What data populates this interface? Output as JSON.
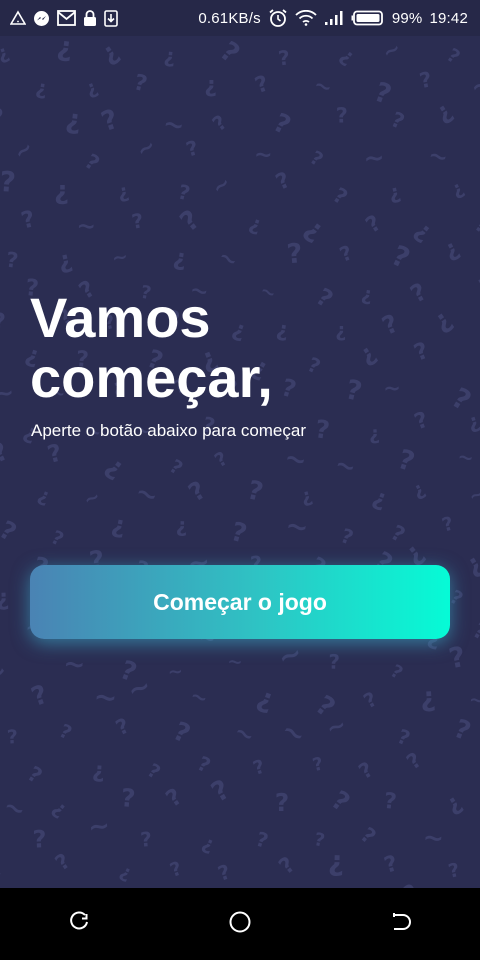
{
  "status_bar": {
    "left_icons": [
      "alert-triangle-icon",
      "messenger-icon",
      "gmail-icon",
      "lock-icon",
      "download-icon"
    ],
    "network_speed": "0.61KB/s",
    "right_icons": [
      "alarm-icon",
      "wifi-icon",
      "signal-icon",
      "battery-icon"
    ],
    "battery_percent": "99%",
    "time": "19:42"
  },
  "main": {
    "title": "Vamos começar,",
    "subtitle": "Aperte o botão abaixo para começar",
    "start_button_label": "Começar o jogo",
    "background_pattern": "question-mark-pattern"
  },
  "nav_bar": {
    "buttons": [
      "recents-icon",
      "home-icon",
      "back-icon"
    ]
  },
  "colors": {
    "background": "#2b2d52",
    "status_bar": "#262848",
    "button_gradient_start": "#4a83b4",
    "button_gradient_end": "#06fbd6",
    "text": "#ffffff"
  }
}
